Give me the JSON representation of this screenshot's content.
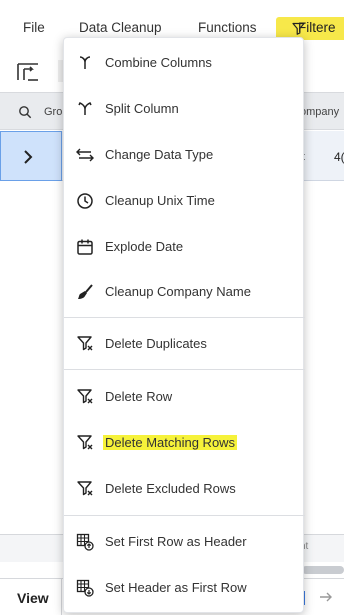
{
  "menubar": {
    "file": "File",
    "data_cleanup": "Data Cleanup",
    "functions": "Functions",
    "filtered": "Filtere"
  },
  "grid": {
    "header_left": "Gro",
    "header_right": "ompany",
    "row_cell_a": "t",
    "row_cell_b": "4("
  },
  "bottom": {
    "input_hint": "nt"
  },
  "footer": {
    "view": "View"
  },
  "dropdown": {
    "items": [
      {
        "label": "Combine Columns",
        "icon": "combine-columns-icon"
      },
      {
        "label": "Split Column",
        "icon": "split-column-icon"
      },
      {
        "label": "Change Data Type",
        "icon": "change-type-icon"
      },
      {
        "label": "Cleanup Unix Time",
        "icon": "clock-icon"
      },
      {
        "label": "Explode Date",
        "icon": "calendar-icon"
      },
      {
        "label": "Cleanup Company Name",
        "icon": "brush-icon"
      },
      {
        "label": "Delete Duplicates",
        "icon": "filter-x-icon"
      },
      {
        "label": "Delete Row",
        "icon": "filter-x-icon"
      },
      {
        "label": "Delete Matching Rows",
        "icon": "filter-x-icon",
        "highlighted": true
      },
      {
        "label": "Delete Excluded Rows",
        "icon": "filter-x-icon"
      },
      {
        "label": "Set First Row as Header",
        "icon": "table-up-icon"
      },
      {
        "label": "Set Header as First Row",
        "icon": "table-down-icon"
      }
    ]
  },
  "colors": {
    "highlight": "#f6f23a",
    "filter_button": "#f7e84a",
    "selection": "#cfe2fb",
    "accent": "#3b7ae0"
  }
}
